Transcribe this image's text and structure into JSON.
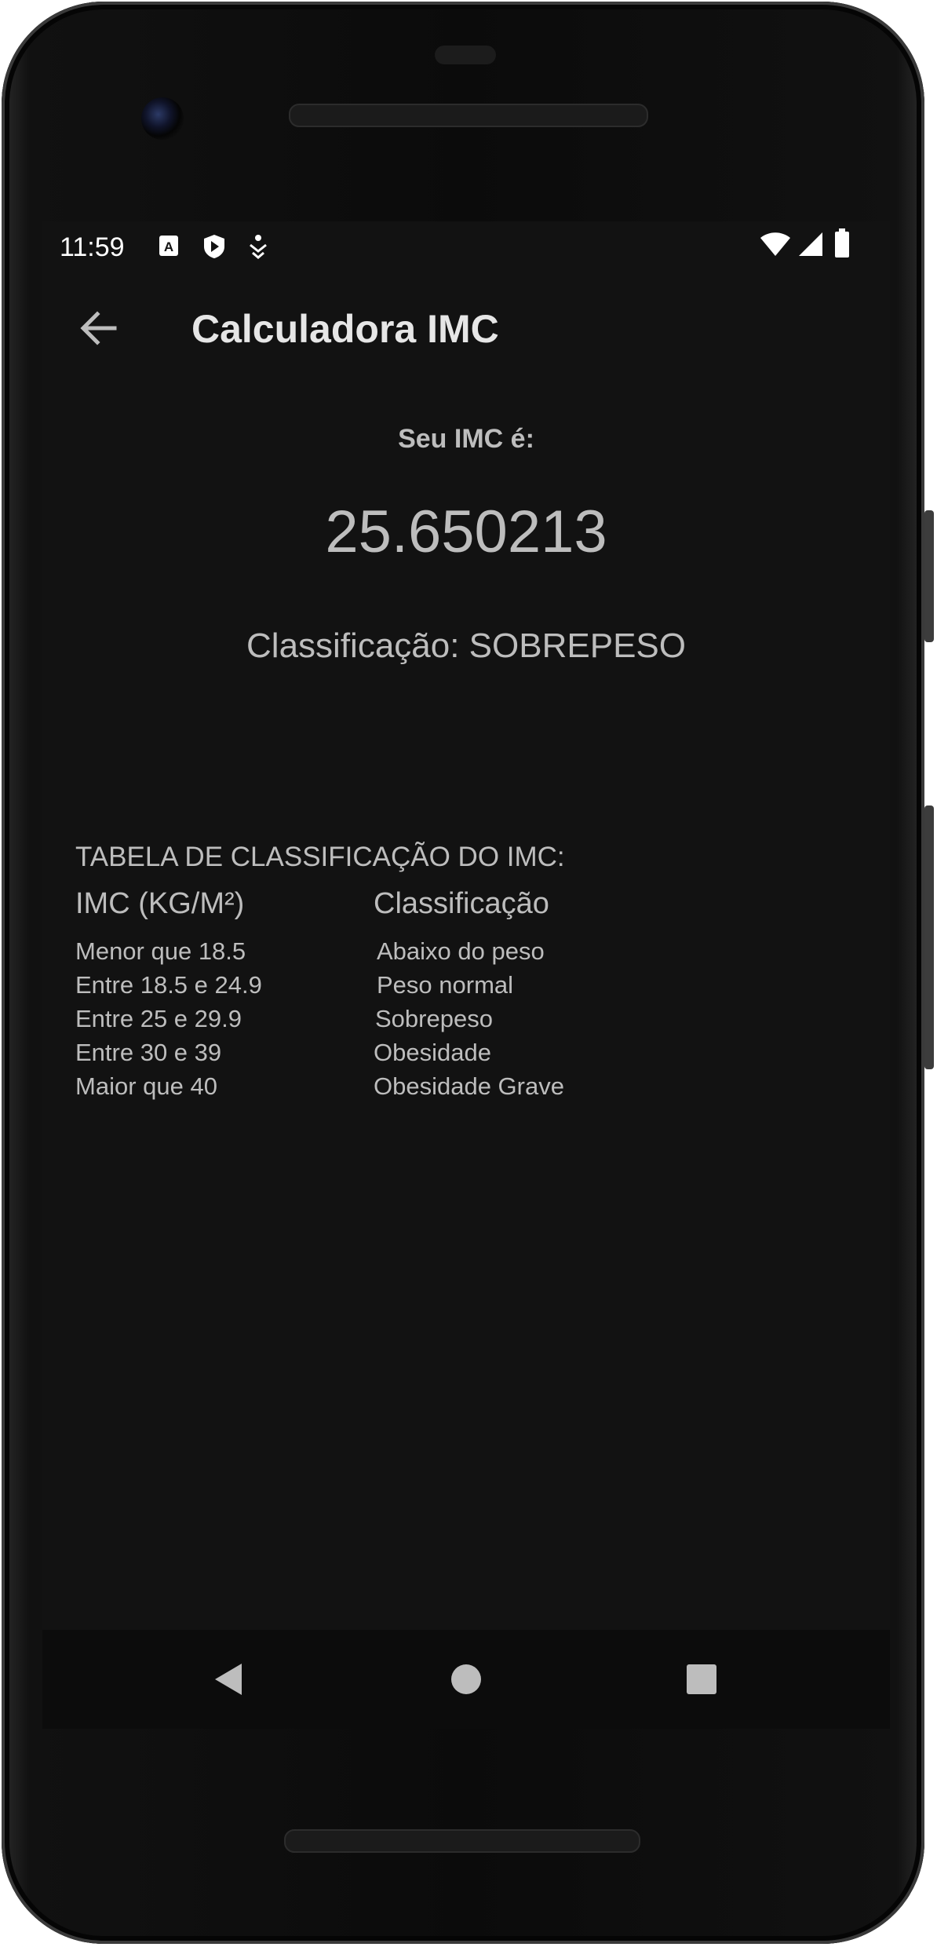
{
  "status_bar": {
    "time": "11:59",
    "icons": [
      "font-a-icon",
      "play-shield-icon",
      "accessibility-icon",
      "wifi-icon",
      "signal-icon",
      "battery-icon"
    ]
  },
  "app_bar": {
    "title": "Calculadora IMC",
    "back_icon": "arrow-back-icon"
  },
  "result": {
    "label": "Seu IMC é:",
    "value": "25.650213",
    "classification": "Classificação: SOBREPESO"
  },
  "table": {
    "title": "TABELA DE CLASSIFICAÇÃO DO IMC:",
    "headers": [
      "IMC (KG/M²)",
      "Classificação"
    ],
    "rows": [
      [
        "Menor que 18.5",
        "Abaixo do peso"
      ],
      [
        "Entre 18.5 e 24.9",
        "Peso normal"
      ],
      [
        "Entre 25 e 29.9",
        "Sobrepeso"
      ],
      [
        "Entre 30 e 39",
        "Obesidade"
      ],
      [
        "Maior que 40",
        "Obesidade Grave"
      ]
    ]
  },
  "nav_bar": {
    "icons": [
      "back-triangle-icon",
      "home-circle-icon",
      "recents-square-icon"
    ]
  },
  "colors": {
    "screen_bg": "#121212",
    "text_primary": "#e6e6e6",
    "text_secondary": "#bdbdbd",
    "nav_icon": "#bdbdbd"
  }
}
